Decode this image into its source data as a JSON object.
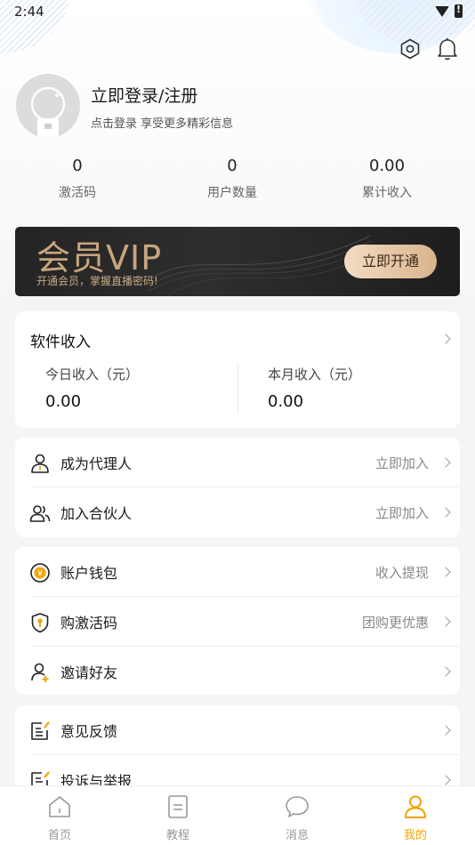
{
  "status_bar": {
    "time": "2:44"
  },
  "user": {
    "login_title": "立即登录/注册",
    "login_subtitle": "点击登录 享受更多精彩信息"
  },
  "stats": [
    {
      "value": "0",
      "label": "激活码"
    },
    {
      "value": "0",
      "label": "用户数量"
    },
    {
      "value": "0.00",
      "label": "累计收入"
    }
  ],
  "vip": {
    "title": "会员VIP",
    "subtitle": "开通会员，掌握直播密码!",
    "button": "立即开通"
  },
  "income": {
    "title": "软件收入",
    "today_label": "今日收入（元）",
    "today_value": "0.00",
    "month_label": "本月收入（元）",
    "month_value": "0.00"
  },
  "agent_card": [
    {
      "label": "成为代理人",
      "hint": "立即加入",
      "icon": "person-icon"
    },
    {
      "label": "加入合伙人",
      "hint": "立即加入",
      "icon": "group-icon"
    }
  ],
  "wallet_card": [
    {
      "label": "账户钱包",
      "hint": "收入提现",
      "icon": "yuan-coin-icon"
    },
    {
      "label": "购激活码",
      "hint": "团购更优惠",
      "icon": "shield-key-icon"
    },
    {
      "label": "邀请好友",
      "hint": "",
      "icon": "invite-person-icon"
    }
  ],
  "feedback_card": [
    {
      "label": "意见反馈",
      "hint": "",
      "icon": "edit-note-icon"
    },
    {
      "label": "投诉与举报",
      "hint": "",
      "icon": "report-note-icon"
    }
  ],
  "bottom_nav": [
    {
      "label": "首页",
      "icon": "home-icon"
    },
    {
      "label": "教程",
      "icon": "document-icon"
    },
    {
      "label": "消息",
      "icon": "chat-bubble-icon"
    },
    {
      "label": "我的",
      "icon": "profile-icon",
      "active": true
    }
  ],
  "colors": {
    "accent": "#f2a300",
    "vip_gold": "#c8a57e"
  }
}
